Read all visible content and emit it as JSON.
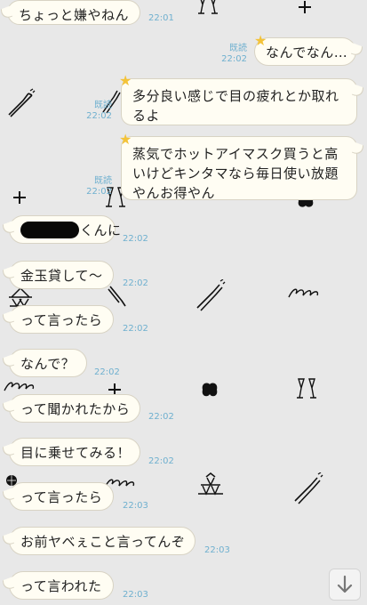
{
  "messages": [
    {
      "text": "ちょっと嫌やねん",
      "time": "22:01"
    },
    {
      "text": "なんでなん…",
      "read": "既読",
      "time": "22:02"
    },
    {
      "text": "多分良い感じで目の疲れとか取れるよ",
      "read": "既読",
      "time": "22:02"
    },
    {
      "text": "蒸気でホットアイマスク買うと高いけどキンタマなら毎日使い放題やんお得やん",
      "read": "既読",
      "time": "22:02"
    },
    {
      "text": "くんに",
      "time": "22:02"
    },
    {
      "text": "金玉貸して〜",
      "time": "22:02"
    },
    {
      "text": "って言ったら",
      "time": "22:02"
    },
    {
      "text": "なんで？",
      "time": "22:02"
    },
    {
      "text": "って聞かれたから",
      "time": "22:02"
    },
    {
      "text": "目に乗せてみる！",
      "time": "22:02"
    },
    {
      "text": "って言ったら",
      "time": "22:03"
    },
    {
      "text": "お前ヤベぇこと言ってんぞ",
      "time": "22:03"
    },
    {
      "text": "って言われた",
      "time": "22:03"
    }
  ],
  "icons": {
    "star": "star-icon",
    "scroll_down": "arrow-down-icon"
  },
  "colors": {
    "background": "#e8e8e8",
    "bubble": "#fffdf3",
    "meta": "#6fb0cf",
    "star": "#f3c33a"
  }
}
